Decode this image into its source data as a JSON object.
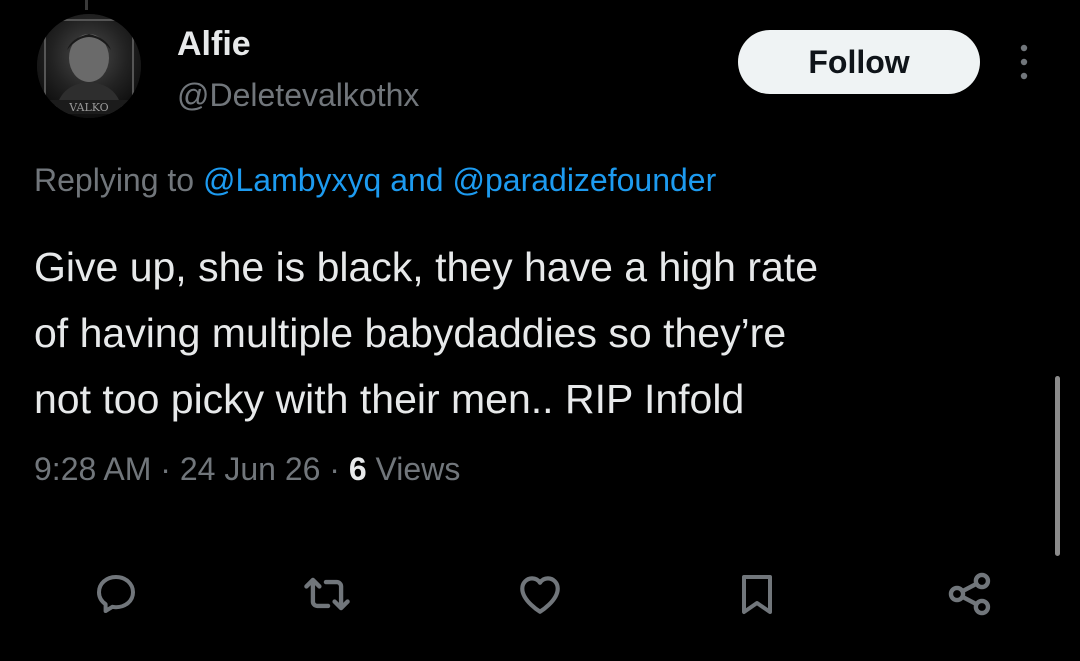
{
  "author": {
    "name": "Alfie",
    "handle": "@Deletevalkothx",
    "avatar_caption": "VALKO"
  },
  "follow_button": {
    "label": "Follow"
  },
  "more_menu": {
    "icon": "more-vertical-icon"
  },
  "reply_context": {
    "prefix": "Replying to ",
    "mention_1": "@Lambyxyq",
    "joiner": " and ",
    "mention_2": "@paradizefounder"
  },
  "tweet": {
    "lines": [
      "Give up, she is black, they have a high rate",
      "of having multiple babydaddies so they’re",
      "not too picky with their men.. RIP Infold"
    ]
  },
  "meta": {
    "time": "9:28 AM",
    "separator": " · ",
    "date": "24 Jun 26",
    "views_count": "6",
    "views_label": " Views"
  },
  "actions": [
    {
      "icon": "reply-icon"
    },
    {
      "icon": "retweet-icon"
    },
    {
      "icon": "like-icon"
    },
    {
      "icon": "bookmark-icon"
    },
    {
      "icon": "share-icon"
    }
  ],
  "colors": {
    "background": "#000000",
    "primary_text": "#e7e9ea",
    "secondary_text": "#71767b",
    "link": "#1d9bf0",
    "follow_bg": "#eff3f4",
    "follow_text": "#0f1419",
    "icon": "#71767b"
  }
}
